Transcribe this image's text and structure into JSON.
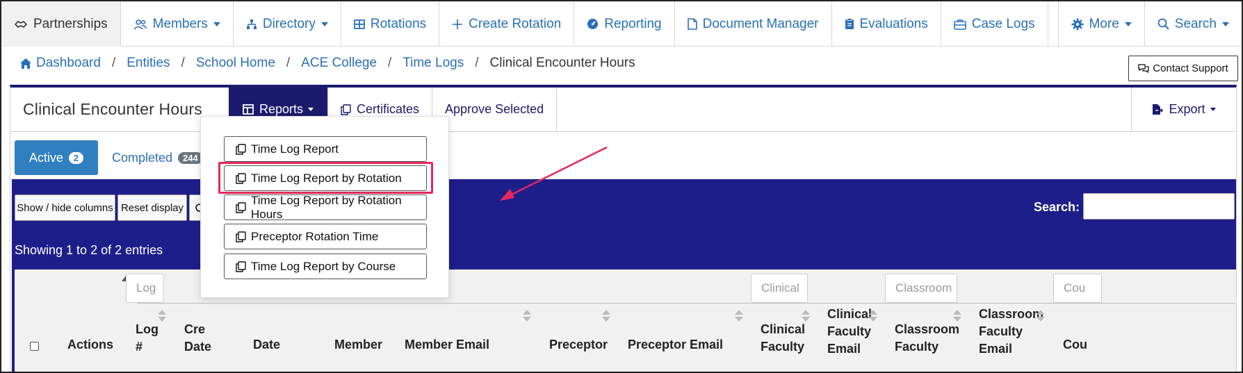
{
  "nav": {
    "items": [
      {
        "label": "Partnerships",
        "icon": "handshake-icon"
      },
      {
        "label": "Members",
        "icon": "users-icon",
        "dropdown": true
      },
      {
        "label": "Directory",
        "icon": "sitemap-icon",
        "dropdown": true
      },
      {
        "label": "Rotations",
        "icon": "grid-icon"
      },
      {
        "label": "Create Rotation",
        "icon": "plus-icon"
      },
      {
        "label": "Reporting",
        "icon": "gauge-icon"
      },
      {
        "label": "Document Manager",
        "icon": "document-icon"
      },
      {
        "label": "Evaluations",
        "icon": "clipboard-icon"
      },
      {
        "label": "Case Logs",
        "icon": "briefcase-icon"
      },
      {
        "label": "More",
        "icon": "gear-icon",
        "dropdown": true
      },
      {
        "label": "Search",
        "icon": "search-icon",
        "dropdown": true
      }
    ]
  },
  "breadcrumb": {
    "items": [
      "Dashboard",
      "Entities",
      "School Home",
      "ACE College",
      "Time Logs"
    ],
    "current": "Clinical Encounter Hours",
    "separator": "/"
  },
  "contact_support": "Contact Support",
  "card": {
    "title": "Clinical Encounter Hours",
    "reports_label": "Reports",
    "certificates_label": "Certificates",
    "approve_label": "Approve Selected",
    "export_label": "Export"
  },
  "tabs": {
    "active_label": "Active",
    "active_count": "2",
    "completed_label": "Completed",
    "completed_count": "244"
  },
  "toolbar": {
    "show_hide": "Show / hide columns",
    "reset": "Reset display",
    "search_label": "Search:"
  },
  "showing_text": "Showing 1 to 2 of 2 entries",
  "filters": {
    "log": "Log",
    "clinical": "Clinical",
    "classroom": "Classroom",
    "course": "Cou"
  },
  "columns": {
    "actions": "Actions",
    "log_num": [
      "Log",
      "#"
    ],
    "created": [
      "Cre",
      "Date"
    ],
    "date": "Date",
    "member": "Member",
    "member_email": "Member Email",
    "preceptor": "Preceptor",
    "preceptor_email": "Preceptor Email",
    "clinical_faculty": [
      "Clinical",
      "Faculty"
    ],
    "clinical_faculty_email": [
      "Clinical",
      "Faculty",
      "Email"
    ],
    "classroom_faculty": [
      "Classroom",
      "Faculty"
    ],
    "classroom_faculty_email": [
      "Classroom",
      "Faculty",
      "Email"
    ],
    "course": "Cou"
  },
  "dropdown": {
    "items": [
      "Time Log Report",
      "Time Log Report by Rotation",
      "Time Log Report by Rotation Hours",
      "Preceptor Rotation Time",
      "Time Log Report by Course"
    ]
  },
  "colors": {
    "nav_link": "#2a6fb8",
    "brand_navy": "#1b1b6e",
    "table_bg": "#1e1e8a",
    "tab_active": "#2f7fc1",
    "highlight": "#e8275a"
  }
}
